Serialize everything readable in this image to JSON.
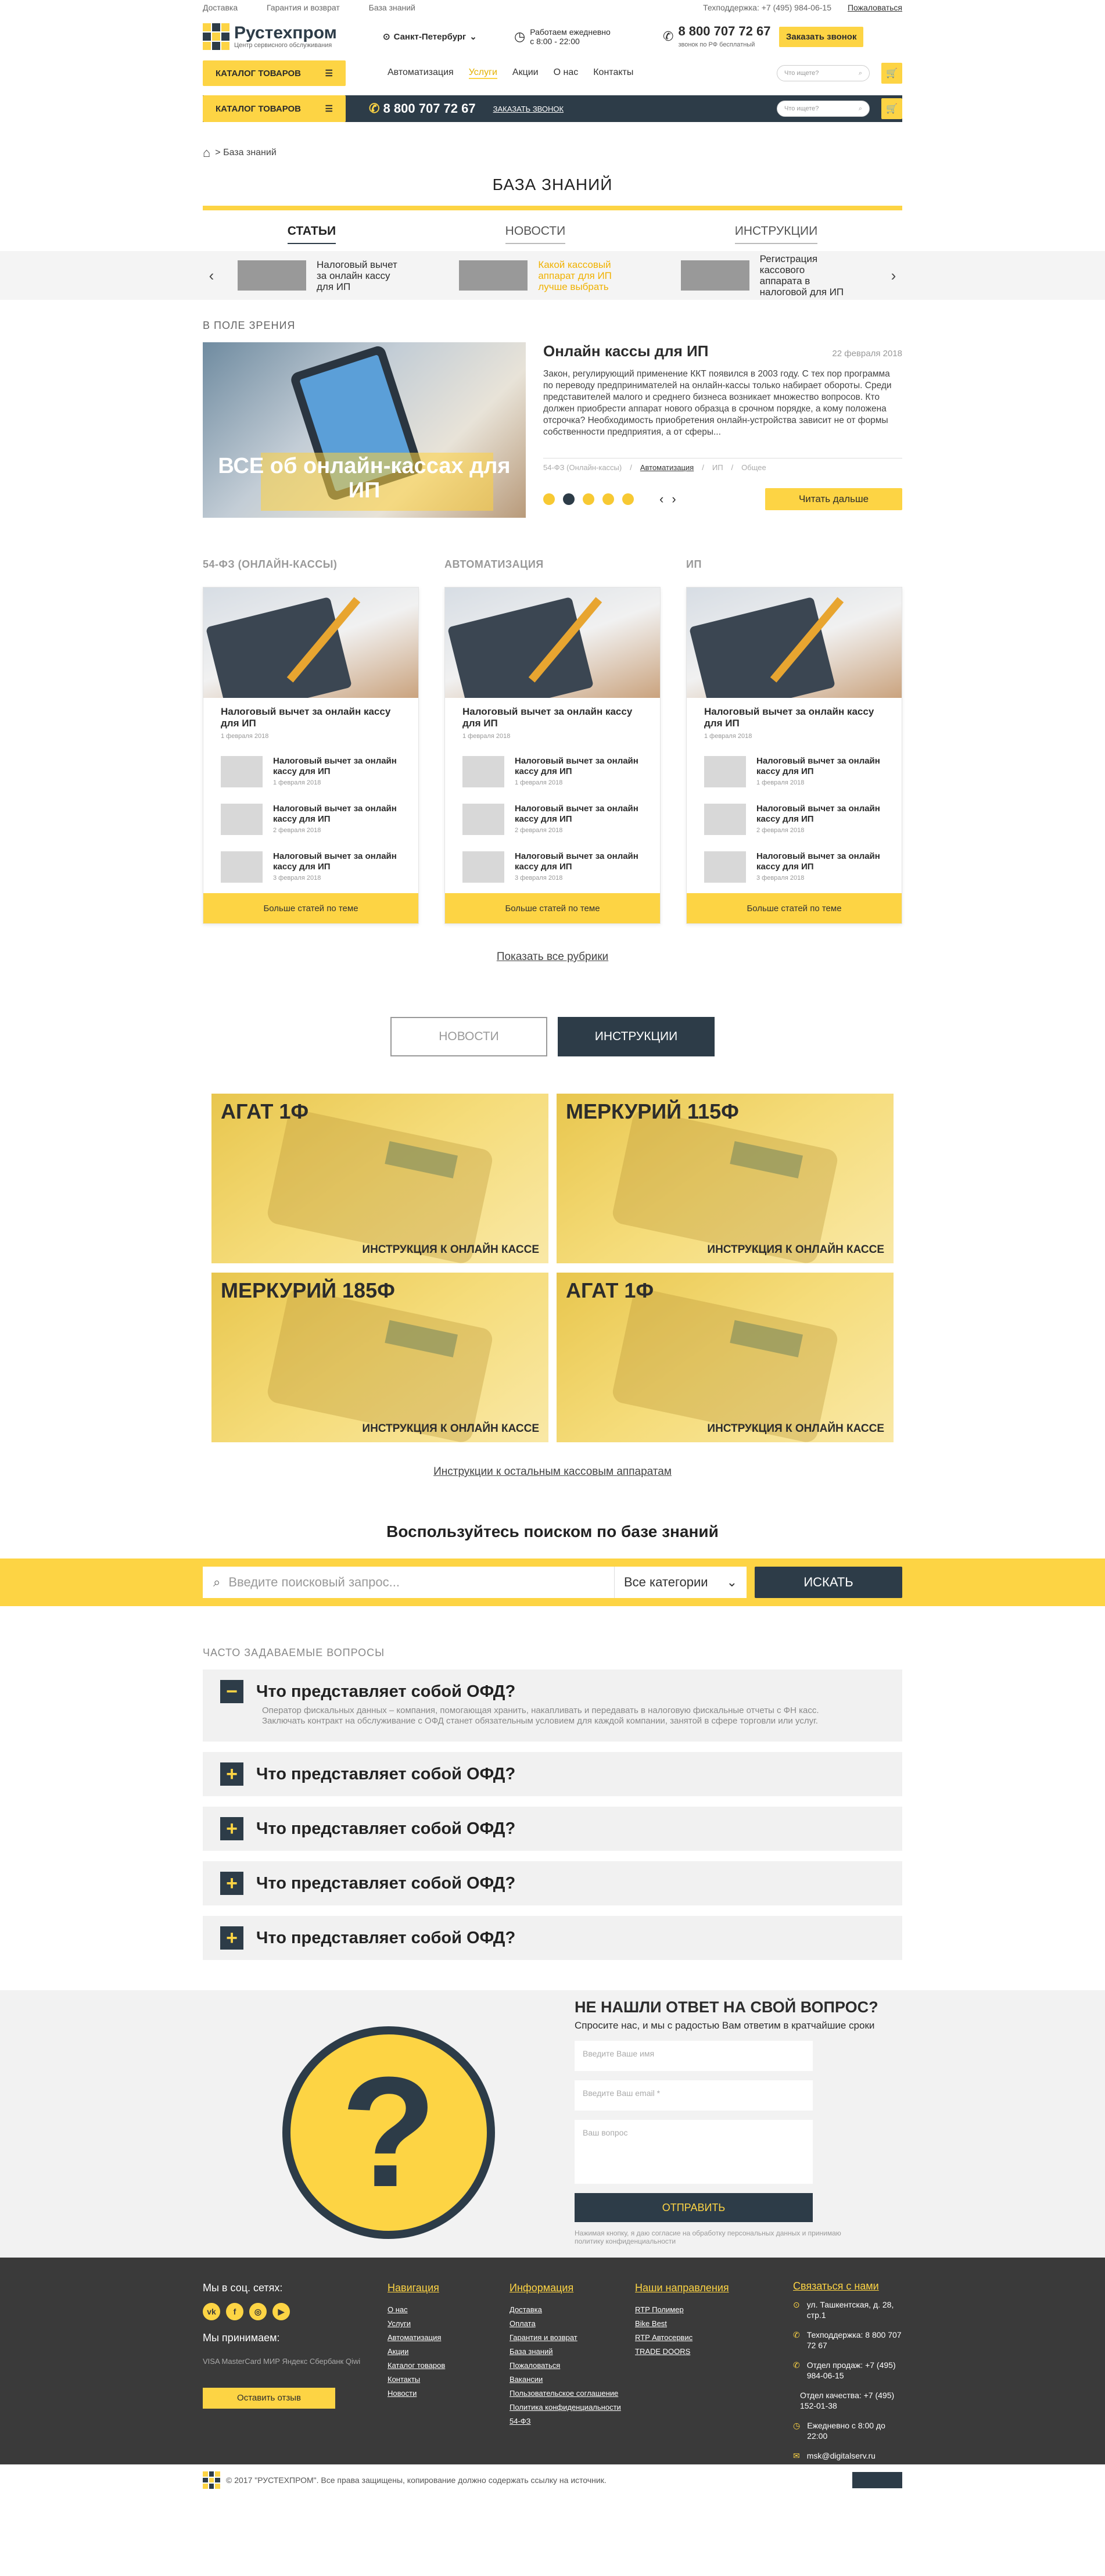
{
  "topbar": {
    "links": [
      "Доставка",
      "Гарантия и возврат",
      "База знаний"
    ],
    "support": "Техподдержка: +7 (495) 984-06-15",
    "complain": "Пожаловаться"
  },
  "header": {
    "logo_name": "Рустехпром",
    "logo_sub": "Центр сервисного обслуживания",
    "city": "Санкт-Петербург",
    "hours_1": "Работаем ежедневно",
    "hours_2": "с 8:00 - 22:00",
    "phone": "8 800 707 72 67",
    "phone_note": "звонок по РФ бесплатный",
    "call_btn": "Заказать звонок"
  },
  "nav": {
    "catalog": "КАТАЛОГ ТОВАРОВ",
    "items": [
      "Автоматизация",
      "Услуги",
      "Акции",
      "О нас",
      "Контакты"
    ],
    "search_placeholder": "Что ищете?",
    "order_call": "ЗАКАЗАТЬ ЗВОНОК"
  },
  "breadcrumb": "> База знаний",
  "page_title": "БАЗА ЗНАНИЙ",
  "tabs": [
    "СТАТЬИ",
    "НОВОСТИ",
    "ИНСТРУКЦИИ"
  ],
  "carousel": [
    "Налоговый вычет за онлайн кассу для ИП",
    "Какой кассовый аппарат для ИП лучше выбрать",
    "Регистрация кассового аппарата в налоговой для ИП"
  ],
  "featured": {
    "label": "В ПОЛЕ ЗРЕНИЯ",
    "image_caption": "ВСЕ об онлайн-кассах для ИП",
    "title": "Онлайн кассы для ИП",
    "date": "22 февраля 2018",
    "text": "Закон, регулирующий применение ККТ появился в 2003 году. С тех пор программа по переводу предпринимателей на онлайн-кассы только набирает обороты. Среди представителей малого и среднего бизнеса возникает множество вопросов. Кто должен приобрести аппарат нового образца в срочном порядке, а кому положена отсрочка? Необходимость приобретения онлайн-устройства зависит не от формы собственности предприятия, а от сферы...",
    "tags": [
      "54-ФЗ (Онлайн-кассы)",
      "/",
      "Автоматизация",
      "/",
      "ИП",
      "/",
      "Общее"
    ],
    "read_more": "Читать дальше"
  },
  "columns": [
    {
      "title": "54-ФЗ (ОНЛАЙН-КАССЫ)",
      "main": "Налоговый вычет за онлайн кассу для ИП",
      "date": "1 февраля 2018",
      "items": [
        {
          "t": "Налоговый вычет за онлайн кассу для ИП",
          "d": "1 февраля 2018"
        },
        {
          "t": "Налоговый вычет за онлайн кассу для ИП",
          "d": "2 февраля 2018"
        },
        {
          "t": "Налоговый вычет за онлайн кассу для ИП",
          "d": "3 февраля 2018"
        }
      ],
      "more": "Больше статей по теме"
    },
    {
      "title": "АВТОМАТИЗАЦИЯ",
      "main": "Налоговый вычет за онлайн кассу для ИП",
      "date": "1 февраля 2018",
      "items": [
        {
          "t": "Налоговый вычет за онлайн кассу для ИП",
          "d": "1 февраля 2018"
        },
        {
          "t": "Налоговый вычет за онлайн кассу для ИП",
          "d": "2 февраля 2018"
        },
        {
          "t": "Налоговый вычет за онлайн кассу для ИП",
          "d": "3 февраля 2018"
        }
      ],
      "more": "Больше статей по теме"
    },
    {
      "title": "ИП",
      "main": "Налоговый вычет за онлайн кассу для ИП",
      "date": "1 февраля 2018",
      "items": [
        {
          "t": "Налоговый вычет за онлайн кассу для ИП",
          "d": "1 февраля 2018"
        },
        {
          "t": "Налоговый вычет за онлайн кассу для ИП",
          "d": "2 февраля 2018"
        },
        {
          "t": "Налоговый вычет за онлайн кассу для ИП",
          "d": "3 февраля 2018"
        }
      ],
      "more": "Больше статей по теме"
    }
  ],
  "show_all": "Показать все рубрики",
  "inst_tabs": [
    "НОВОСТИ",
    "ИНСТРУКЦИИ"
  ],
  "instructions": [
    {
      "name": "АГАТ 1Ф",
      "sub": "ИНСТРУКЦИЯ К ОНЛАЙН КАССЕ"
    },
    {
      "name": "МЕРКУРИЙ 115Ф",
      "sub": "ИНСТРУКЦИЯ К ОНЛАЙН КАССЕ"
    },
    {
      "name": "МЕРКУРИЙ 185Ф",
      "sub": "ИНСТРУКЦИЯ К ОНЛАЙН КАССЕ"
    },
    {
      "name": "АГАТ 1Ф",
      "sub": "ИНСТРУКЦИЯ К ОНЛАЙН КАССЕ"
    }
  ],
  "inst_more": "Инструкции к остальным кассовым аппаратам",
  "ksearch": {
    "title": "Воспользуйтесь поиском по базе знаний",
    "placeholder": "Введите поисковый запрос...",
    "category": "Все категории",
    "button": "ИСКАТЬ"
  },
  "faq": {
    "label": "ЧАСТО ЗАДАВАЕМЫЕ ВОПРОСЫ",
    "items": [
      "Что представляет собой ОФД?",
      "Что представляет собой ОФД?",
      "Что представляет собой ОФД?",
      "Что представляет собой ОФД?",
      "Что представляет собой ОФД?"
    ],
    "answer": "Оператор фискальных данных – компания, помогающая хранить, накапливать и передавать в налоговую фискальные отчеты с ФН касс. Заключать контракт на обслуживание с ОФД станет обязательным условием для каждой компании, занятой в сфере торговли или услуг."
  },
  "ask": {
    "title": "НЕ НАШЛИ ОТВЕТ НА СВОЙ ВОПРОС?",
    "sub": "Спросите нас, и мы с радостью Вам ответим в кратчайшие сроки",
    "name": "Введите Ваше имя",
    "email": "Введите Ваш email *",
    "question": "Ваш вопрос",
    "send": "ОТПРАВИТЬ",
    "note": "Нажимая кнопку, я даю согласие на обработку персональных данных и принимаю политику конфиденциальности"
  },
  "footer": {
    "social_title": "Мы в соц. сетях:",
    "pay_title": "Мы принимаем:",
    "pay": "VISA  MasterCard  МИР  Яндекс  Сбербанк  Qiwi",
    "review": "Оставить отзыв",
    "nav_title": "Навигация",
    "nav": [
      "О нас",
      "Услуги",
      "Автоматизация",
      "Акции",
      "Каталог товаров",
      "Контакты",
      "Новости"
    ],
    "info_title": "Информация",
    "info": [
      "Доставка",
      "Оплата",
      "Гарантия и возврат",
      "База знаний",
      "Пожаловаться",
      "Вакансии",
      "Пользовательское соглашение",
      "Политика конфиденциальности",
      "54-ФЗ"
    ],
    "dir_title": "Наши направления",
    "dir": [
      "RTP Полимер",
      "Bike Best",
      "RTP Автосервис",
      "TRADE DOORS"
    ],
    "contact_title": "Связаться с нами",
    "address": "ул. Ташкентская, д. 28, стр.1",
    "support": "Техподдержка: 8 800 707 72 67",
    "sales": "Отдел продаж: +7 (495) 984-06-15",
    "quality": "Отдел качества: +7 (495) 152-01-38",
    "hours": "Ежедневно с 8:00 до 22:00",
    "email": "msk@digitalserv.ru"
  },
  "copyright": "© 2017 \"РУСТЕХПРОМ\". Все права защищены, копирование должно содержать ссылку на источник."
}
